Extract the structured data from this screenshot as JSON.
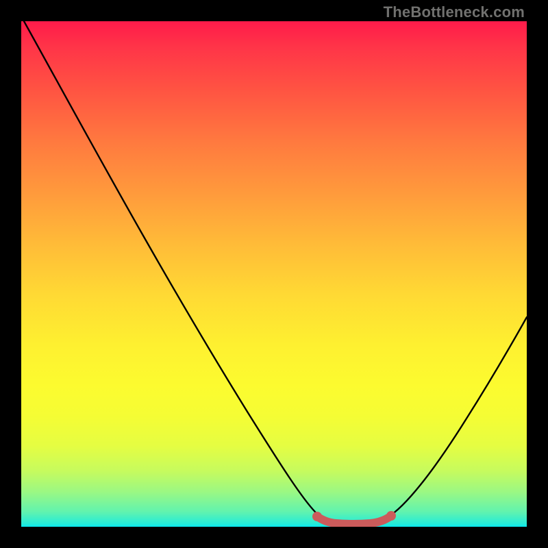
{
  "watermark": {
    "text": "TheBottleneck.com"
  },
  "colors": {
    "background": "#000000",
    "curve": "#000000",
    "flat_segment": "#cb5b5b",
    "gradient_top": "#ff1b4a",
    "gradient_bottom": "#06e7f0"
  },
  "chart_data": {
    "type": "line",
    "title": "",
    "xlabel": "",
    "ylabel": "",
    "xlim": [
      0,
      100
    ],
    "ylim": [
      0,
      100
    ],
    "grid": false,
    "legend": false,
    "series": [
      {
        "name": "curve",
        "x": [
          0,
          5,
          10,
          15,
          20,
          25,
          30,
          35,
          40,
          45,
          50,
          55,
          58,
          60,
          63,
          67,
          70,
          73,
          75,
          80,
          85,
          90,
          95,
          100
        ],
        "values": [
          100,
          92,
          83,
          75,
          66,
          57,
          48,
          40,
          31,
          22,
          13,
          5,
          2,
          1,
          0.5,
          0.5,
          0.5,
          1,
          3,
          10,
          19,
          29,
          40,
          52
        ]
      },
      {
        "name": "flat-segment",
        "x": [
          58,
          60,
          63,
          66,
          69,
          72,
          73
        ],
        "values": [
          1.8,
          1.2,
          1.0,
          1.0,
          1.0,
          1.2,
          1.8
        ]
      }
    ],
    "annotations": []
  }
}
